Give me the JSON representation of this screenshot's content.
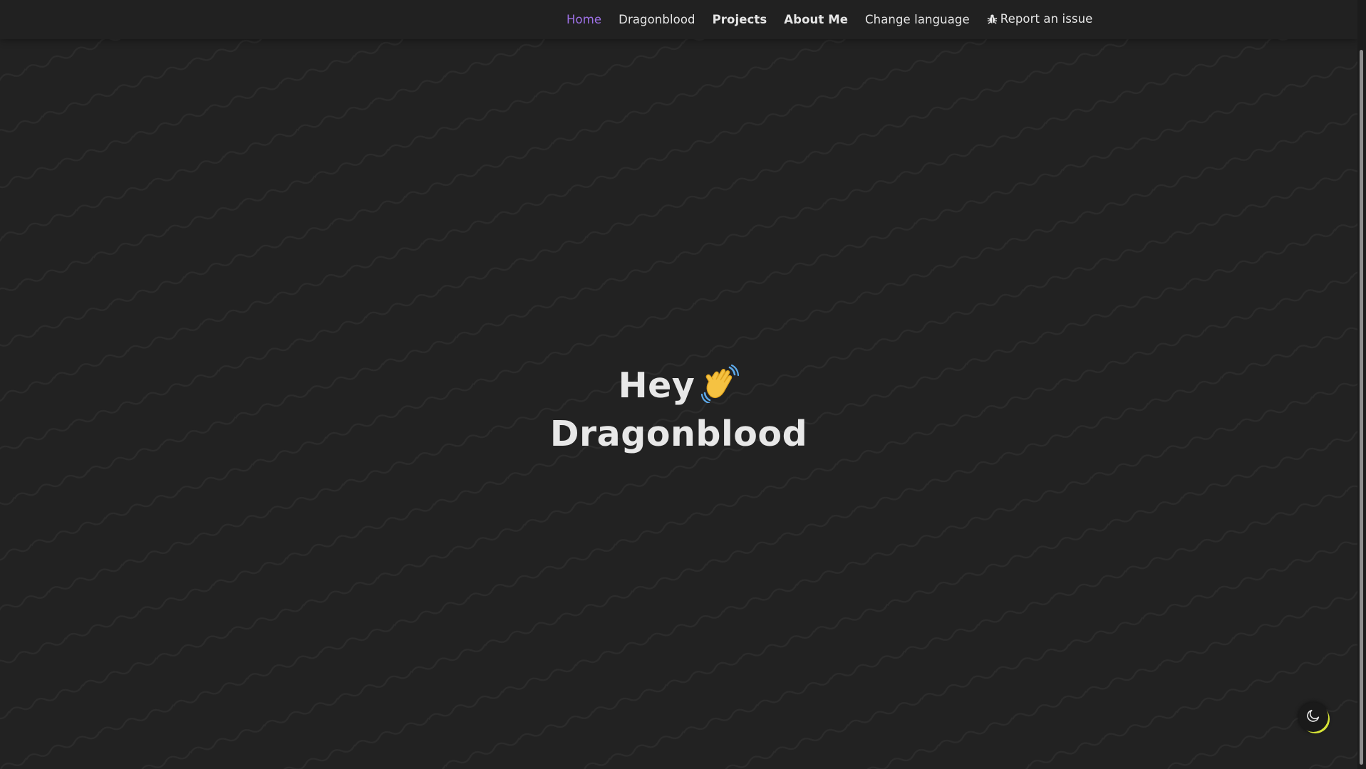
{
  "nav": {
    "items": [
      {
        "label": "Home",
        "state": "active"
      },
      {
        "label": "Dragonblood",
        "state": "normal"
      },
      {
        "label": "Projects",
        "state": "bold"
      },
      {
        "label": "About Me",
        "state": "bold"
      },
      {
        "label": "Change language",
        "state": "normal"
      },
      {
        "label": "Report an issue",
        "state": "normal",
        "icon": "bug-icon"
      }
    ]
  },
  "hero": {
    "line1": "Hey",
    "line2": "Dragonblood",
    "icon": "waving-hand-icon"
  },
  "theme_toggle": {
    "icon": "moon-icon"
  },
  "colors": {
    "background": "#222222",
    "navbar": "#212121",
    "text": "#e8e8e8",
    "accent": "#9f72e8",
    "toggle_ring": "#d7e437"
  }
}
